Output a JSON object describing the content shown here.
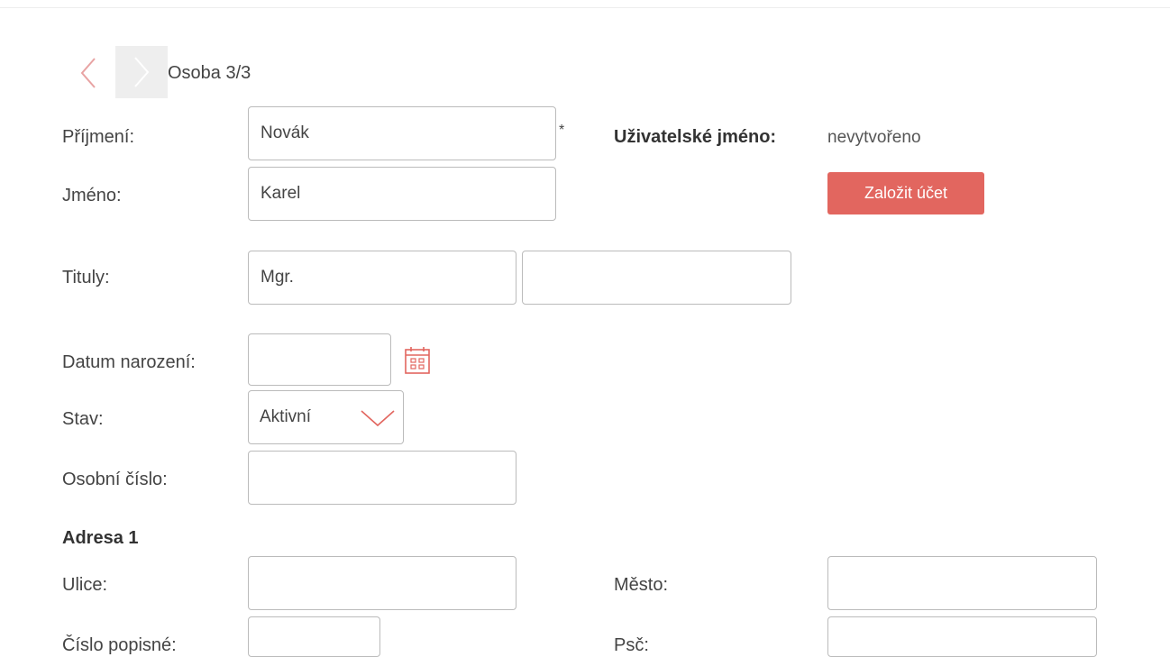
{
  "navigation": {
    "prev_icon": "chevron-left-icon",
    "next_icon": "chevron-right-icon",
    "record_title": "Osoba 3/3"
  },
  "person": {
    "surname_label": "Příjmení:",
    "surname_value": "Novák",
    "required_mark": "*",
    "first_name_label": "Jméno:",
    "first_name_value": "Karel",
    "titles_label": "Tituly:",
    "title_before_value": "Mgr.",
    "title_after_value": "",
    "birth_date_label": "Datum narození:",
    "birth_date_value": "",
    "calendar_icon": "calendar-icon",
    "status_label": "Stav:",
    "status_value": "Aktivní",
    "personal_number_label": "Osobní číslo:",
    "personal_number_value": ""
  },
  "account": {
    "username_label": "Uživatelské jméno:",
    "username_value": "nevytvořeno",
    "create_button_label": "Založit účet"
  },
  "address": {
    "section_title": "Adresa 1",
    "street_label": "Ulice:",
    "street_value": "",
    "house_number_label": "Číslo popisné:",
    "house_number_value": "",
    "city_label": "Město:",
    "city_value": "",
    "zip_label": "Psč:",
    "zip_value": ""
  },
  "colors": {
    "accent": "#e2665f",
    "nav_prev_icon": "#e8a3a3",
    "nav_next_bg": "#eeeeee",
    "border": "#bbbbbb"
  }
}
